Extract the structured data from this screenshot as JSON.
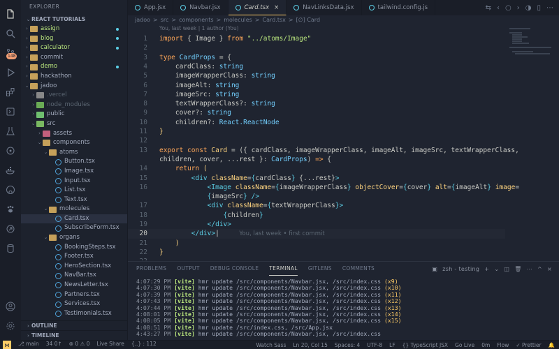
{
  "activity_bar": {
    "icons": [
      "files-icon",
      "search-icon",
      "source-control-icon",
      "run-debug-icon",
      "extensions-icon",
      "remote-explorer-icon",
      "testing-icon",
      "git-graph-icon",
      "docker-icon",
      "github-icon",
      "paw-icon",
      "live-share-icon",
      "database-icon"
    ],
    "badge": "148"
  },
  "sidebar": {
    "title": "EXPLORER",
    "section": "REACT TUTORIALS",
    "outline": "OUTLINE",
    "timeline": "TIMELINE",
    "tree": [
      {
        "label": "assign",
        "depth": 1,
        "kind": "folder",
        "open": false,
        "mod": true,
        "dot": true
      },
      {
        "label": "blog",
        "depth": 1,
        "kind": "folder",
        "open": false,
        "mod": true,
        "dot": true
      },
      {
        "label": "calculator",
        "depth": 1,
        "kind": "folder",
        "open": false,
        "mod": true,
        "dot": true
      },
      {
        "label": "commit",
        "depth": 1,
        "kind": "folder",
        "open": false
      },
      {
        "label": "demo",
        "depth": 1,
        "kind": "folder",
        "open": false,
        "mod": true,
        "dot": true
      },
      {
        "label": "hackathon",
        "depth": 1,
        "kind": "folder",
        "open": false
      },
      {
        "label": "jadoo",
        "depth": 1,
        "kind": "folder",
        "open": true
      },
      {
        "label": ".vercel",
        "depth": 2,
        "kind": "folder",
        "open": false,
        "variant": "vercel",
        "dim": true
      },
      {
        "label": "node_modules",
        "depth": 2,
        "kind": "folder",
        "open": false,
        "variant": "nm",
        "dim": true
      },
      {
        "label": "public",
        "depth": 2,
        "kind": "folder",
        "open": false,
        "variant": "pub"
      },
      {
        "label": "src",
        "depth": 2,
        "kind": "folder",
        "open": true,
        "variant": "src"
      },
      {
        "label": "assets",
        "depth": 3,
        "kind": "folder",
        "open": false,
        "variant": "assets"
      },
      {
        "label": "components",
        "depth": 3,
        "kind": "folder",
        "open": true
      },
      {
        "label": "atoms",
        "depth": 4,
        "kind": "folder",
        "open": true
      },
      {
        "label": "Button.tsx",
        "depth": 5,
        "kind": "file"
      },
      {
        "label": "Image.tsx",
        "depth": 5,
        "kind": "file"
      },
      {
        "label": "Input.tsx",
        "depth": 5,
        "kind": "file"
      },
      {
        "label": "List.tsx",
        "depth": 5,
        "kind": "file"
      },
      {
        "label": "Text.tsx",
        "depth": 5,
        "kind": "file"
      },
      {
        "label": "molecules",
        "depth": 4,
        "kind": "folder",
        "open": true
      },
      {
        "label": "Card.tsx",
        "depth": 5,
        "kind": "file",
        "selected": true
      },
      {
        "label": "SubscribeForm.tsx",
        "depth": 5,
        "kind": "file"
      },
      {
        "label": "organs",
        "depth": 4,
        "kind": "folder",
        "open": true
      },
      {
        "label": "BookingSteps.tsx",
        "depth": 5,
        "kind": "file"
      },
      {
        "label": "Footer.tsx",
        "depth": 5,
        "kind": "file"
      },
      {
        "label": "HeroSection.tsx",
        "depth": 5,
        "kind": "file"
      },
      {
        "label": "NavBar.tsx",
        "depth": 5,
        "kind": "file"
      },
      {
        "label": "NewsLetter.tsx",
        "depth": 5,
        "kind": "file"
      },
      {
        "label": "Partners.tsx",
        "depth": 5,
        "kind": "file"
      },
      {
        "label": "Services.tsx",
        "depth": 5,
        "kind": "file"
      },
      {
        "label": "Testimonials.tsx",
        "depth": 5,
        "kind": "file"
      }
    ]
  },
  "tabs": [
    {
      "label": "App.jsx",
      "active": false
    },
    {
      "label": "Navbar.jsx",
      "active": false
    },
    {
      "label": "Card.tsx",
      "active": true,
      "close": "×"
    },
    {
      "label": "NavLinksData.jsx",
      "active": false
    },
    {
      "label": "tailwind.config.js",
      "active": false
    }
  ],
  "breadcrumb": [
    "jadoo",
    ">",
    "src",
    ">",
    "components",
    ">",
    "molecules",
    ">",
    "Card.tsx",
    ">",
    "[∅] Card"
  ],
  "editor": {
    "blame": "You, last week | 1 author (You)",
    "current_line": "20",
    "ghost_text": "You, last week • first commit"
  },
  "panel": {
    "tabs": [
      "PROBLEMS",
      "OUTPUT",
      "DEBUG CONSOLE",
      "TERMINAL",
      "GITLENS",
      "COMMENTS"
    ],
    "active_tab": "TERMINAL",
    "terminal_name": "zsh - testing",
    "log": [
      {
        "time": "4:07:29 PM",
        "tag": "[vite]",
        "msg": "hmr update /src/components/Navbar.jsx, /src/index.css",
        "count": "(x9)"
      },
      {
        "time": "4:07:30 PM",
        "tag": "[vite]",
        "msg": "hmr update /src/components/Navbar.jsx, /src/index.css",
        "count": "(x10)"
      },
      {
        "time": "4:07:39 PM",
        "tag": "[vite]",
        "msg": "hmr update /src/components/Navbar.jsx, /src/index.css",
        "count": "(x11)"
      },
      {
        "time": "4:07:43 PM",
        "tag": "[vite]",
        "msg": "hmr update /src/components/Navbar.jsx, /src/index.css",
        "count": "(x12)"
      },
      {
        "time": "4:07:44 PM",
        "tag": "[vite]",
        "msg": "hmr update /src/components/Navbar.jsx, /src/index.css",
        "count": "(x13)"
      },
      {
        "time": "4:08:01 PM",
        "tag": "[vite]",
        "msg": "hmr update /src/components/Navbar.jsx, /src/index.css",
        "count": "(x14)"
      },
      {
        "time": "4:08:05 PM",
        "tag": "[vite]",
        "msg": "hmr update /src/components/Navbar.jsx, /src/index.css",
        "count": "(x15)"
      },
      {
        "time": "4:08:51 PM",
        "tag": "[vite]",
        "msg": "hmr update /src/index.css, /src/App.jsx",
        "count": ""
      },
      {
        "time": "4:43:27 PM",
        "tag": "[vite]",
        "msg": "hmr update /src/components/Navbar.jsx, /src/index.css",
        "count": ""
      }
    ]
  },
  "status": {
    "branch": "main",
    "sync": "34 0↑",
    "errors": "⊗ 0 ⚠ 0",
    "live_share": "Live Share",
    "selection": "{..} : 112",
    "watch_sass": "Watch Sass",
    "position": "Ln 20, Col 15",
    "spaces": "Spaces: 4",
    "encoding": "UTF-8",
    "eol": "LF",
    "language": "{} TypeScript JSX",
    "go_live": "Go Live",
    "time": "0m",
    "flow": "Flow",
    "prettier": "✓ Prettier"
  },
  "colors": {
    "background": "#1f2430",
    "keyword": "#ffa759",
    "type": "#73d0ff",
    "string": "#bae67e",
    "function": "#ffd580",
    "tag": "#5ccfe6"
  }
}
